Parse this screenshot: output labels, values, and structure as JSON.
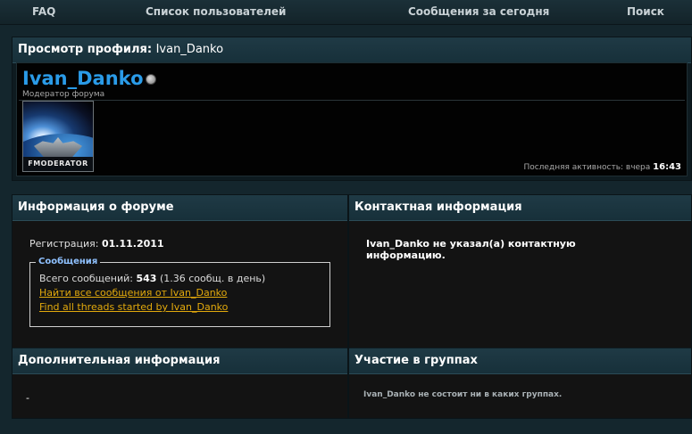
{
  "navbar": {
    "items": [
      "FAQ",
      "Список пользователей",
      "Сообщения за сегодня",
      "Поиск"
    ]
  },
  "profile_panel": {
    "title_prefix": "Просмотр профиля:",
    "title_name": "Ivan_Danko",
    "username": "Ivan_Danko",
    "usertitle": "Модератор форума",
    "avatar_caption": "FMODERATOR",
    "last_activity_label": "Последняя активность: вчера",
    "last_activity_time": "16:43"
  },
  "forum_info": {
    "title": "Информация о форуме",
    "registration_label": "Регистрация:",
    "registration_date": "01.11.2011",
    "messages": {
      "legend": "Сообщения",
      "total_label": "Всего сообщений:",
      "total_value": "543",
      "per_day": "(1.36 сообщ. в день)",
      "link_all_posts": "Найти все сообщения от Ivan_Danko",
      "link_all_threads": "Find all threads started by Ivan_Danko"
    }
  },
  "contact_info": {
    "title": "Контактная информация",
    "text": "Ivan_Danko не указал(а) контактную информацию."
  },
  "additional_info": {
    "title": "Дополнительная информация",
    "value": "-"
  },
  "groups": {
    "title": "Участие в группах",
    "text": "Ivan_Danko не состоит ни в каких группах."
  },
  "colors": {
    "accent_username": "#2a9be8",
    "link": "#e2a90c",
    "legend": "#8fc1ff"
  }
}
